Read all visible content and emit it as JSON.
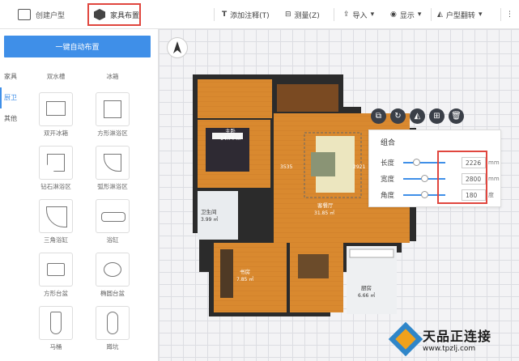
{
  "topbar": {
    "tab_create": "创建户型",
    "tab_furniture": "家具布置",
    "tools": [
      {
        "label": "添加注释(T)",
        "icon": "text-cursor-icon"
      },
      {
        "label": "测量(Z)",
        "icon": "ruler-icon"
      },
      {
        "label": "导入",
        "icon": "upload-icon"
      },
      {
        "label": "显示",
        "icon": "eye-icon"
      },
      {
        "label": "户型翻转",
        "icon": "flip-icon"
      }
    ]
  },
  "sidebar": {
    "auto_button": "一键自动布置",
    "categories": [
      "家具",
      "厨卫",
      "其他"
    ],
    "active_category": "厨卫",
    "items": [
      {
        "label": "双水槽"
      },
      {
        "label": "冰箱"
      },
      {
        "label": "双开冰箱"
      },
      {
        "label": "方形淋浴区"
      },
      {
        "label": "钻石淋浴区"
      },
      {
        "label": "弧形淋浴区"
      },
      {
        "label": "三角浴缸"
      },
      {
        "label": "浴缸"
      },
      {
        "label": "方形台盆"
      },
      {
        "label": "椭圆台盆"
      },
      {
        "label": "马桶"
      },
      {
        "label": "蹲坑"
      }
    ]
  },
  "floorplan": {
    "rooms": [
      {
        "name": "主卧",
        "area": "14.74 ㎡"
      },
      {
        "name": "卫生间",
        "area": "3.99 ㎡"
      },
      {
        "name": "客餐厅",
        "area": "31.85 ㎡"
      },
      {
        "name": "书房",
        "area": "7.85 ㎡"
      },
      {
        "name": "厨房",
        "area": "6.66 ㎡"
      }
    ],
    "dims": [
      "3535",
      "2921"
    ]
  },
  "props": {
    "title": "组合",
    "rows": [
      {
        "label": "长度",
        "value": "2226",
        "unit": "mm",
        "pos": 0.3
      },
      {
        "label": "宽度",
        "value": "2800",
        "unit": "mm",
        "pos": 0.5
      },
      {
        "label": "角度",
        "value": "180",
        "unit": "度",
        "pos": 0.5
      }
    ]
  },
  "watermark": {
    "name": "天品正连接",
    "url": "www.tpzlj.com"
  },
  "colors": {
    "accent": "#3f8fe8",
    "highlight": "#e0463e",
    "floor": "#d9892f",
    "wall": "#2b2b2b"
  }
}
